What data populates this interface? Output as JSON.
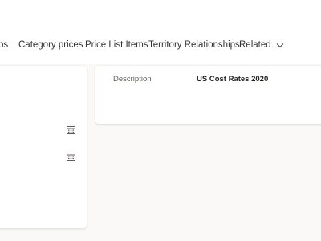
{
  "tabs": [
    {
      "label": "ps"
    },
    {
      "label": "Category prices"
    },
    {
      "label": "Price List Items"
    },
    {
      "label": "Territory Relationships"
    },
    {
      "label": "Related"
    }
  ],
  "detail": {
    "description_label": "Description",
    "description_value": "US Cost Rates 2020"
  },
  "icons": {
    "date_picker_1": "calendar-icon",
    "date_picker_2": "calendar-icon",
    "related_dropdown": "chevron-down-icon"
  },
  "colors": {
    "page_background": "#faf9f8",
    "card_background": "#ffffff",
    "text_primary": "#323130",
    "text_secondary": "#605e5c"
  }
}
